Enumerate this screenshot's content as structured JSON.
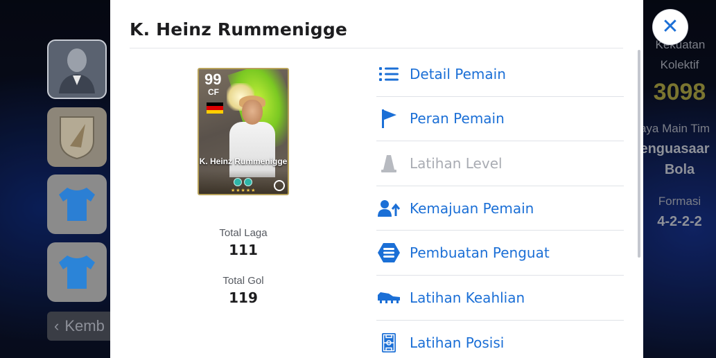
{
  "background": {
    "back_button_label": "Kemb",
    "right_panel": {
      "strength_label": "Kekuatan Kolektif",
      "strength_value": "3098",
      "play_style_label": "aya Main Tim",
      "play_style_value_line1": "enguasaar",
      "play_style_value_line2": "Bola",
      "formation_label": "Formasi",
      "formation_value": "4-2-2-2"
    }
  },
  "close_button": {
    "icon": "close-icon",
    "color": "#1b6fd6"
  },
  "modal": {
    "title": "K. Heinz Rummenigge",
    "card": {
      "rating": "99",
      "position": "CF",
      "nationality_flag": "germany-flag-icon",
      "name": "K. Heinz Rummenigge",
      "stars": "★★★★★"
    },
    "stats": {
      "matches_label": "Total Laga",
      "matches_value": "111",
      "goals_label": "Total Gol",
      "goals_value": "119"
    },
    "menu": [
      {
        "label": "Detail Pemain",
        "icon": "list-icon",
        "enabled": true
      },
      {
        "label": "Peran Pemain",
        "icon": "flag-icon",
        "enabled": true
      },
      {
        "label": "Latihan Level",
        "icon": "cone-icon",
        "enabled": false
      },
      {
        "label": "Kemajuan Pemain",
        "icon": "player-progress-icon",
        "enabled": true
      },
      {
        "label": "Pembuatan Penguat",
        "icon": "booster-icon",
        "enabled": true
      },
      {
        "label": "Latihan Keahlian",
        "icon": "boot-icon",
        "enabled": true
      },
      {
        "label": "Latihan Posisi",
        "icon": "pitch-icon",
        "enabled": true
      }
    ],
    "accent_color": "#1b6fd6",
    "disabled_color": "#a9acb3"
  }
}
